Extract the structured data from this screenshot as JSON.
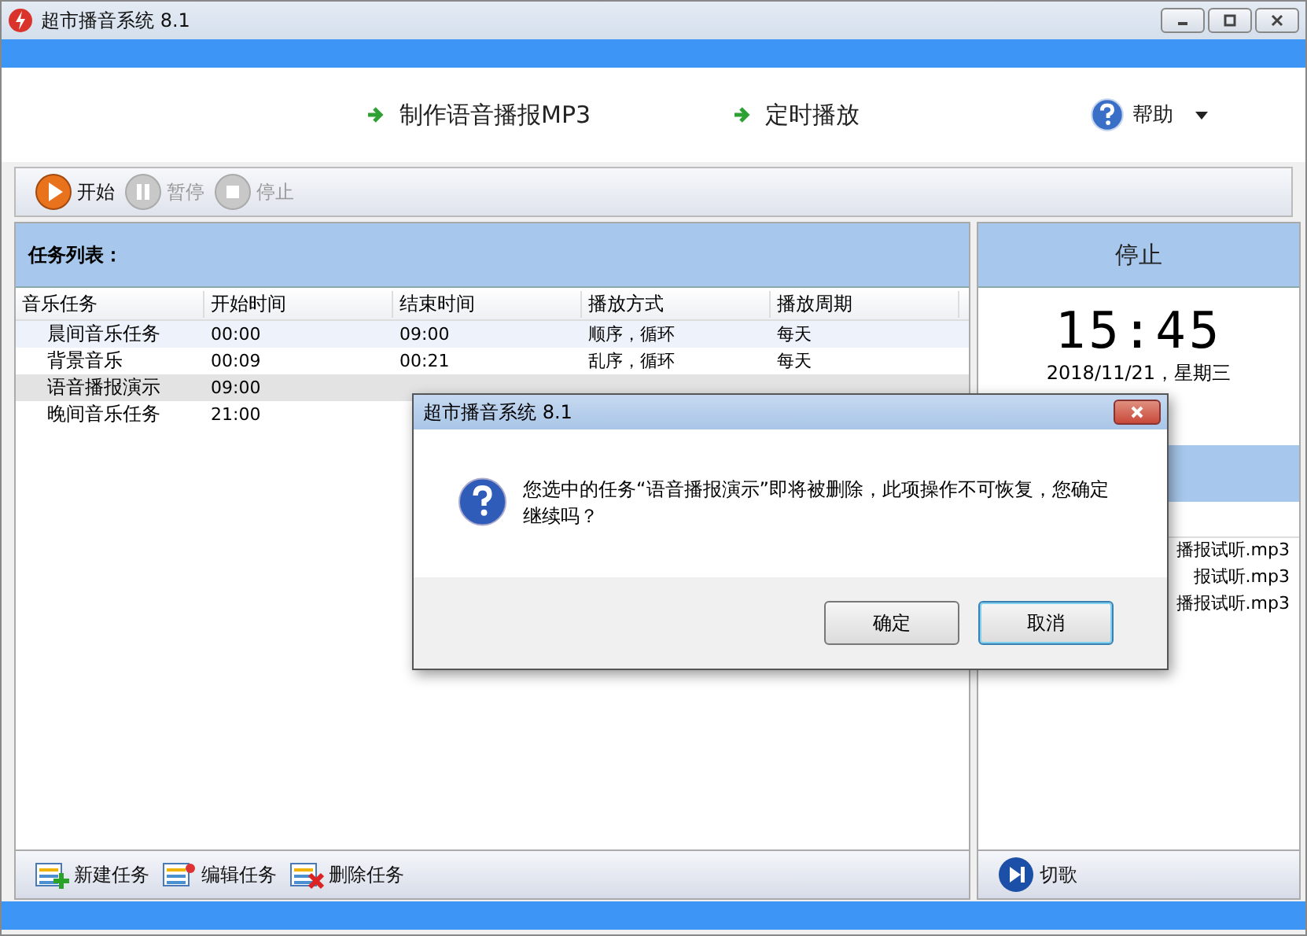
{
  "window": {
    "title": "超市播音系统 8.1"
  },
  "nav": [
    {
      "label": "制作语音播报MP3",
      "kind": "arrow"
    },
    {
      "label": "定时播放",
      "kind": "arrow"
    },
    {
      "label": "帮助",
      "kind": "help"
    }
  ],
  "toolbar": [
    {
      "label": "开始",
      "kind": "play",
      "disabled": false
    },
    {
      "label": "暂停",
      "kind": "pause",
      "disabled": true
    },
    {
      "label": "停止",
      "kind": "stop",
      "disabled": true
    }
  ],
  "task_panel": {
    "title": "任务列表：",
    "columns": [
      "音乐任务",
      "开始时间",
      "结束时间",
      "播放方式",
      "播放周期"
    ],
    "rows": [
      {
        "selected": false,
        "cells": [
          "晨间音乐任务",
          "00:00",
          "09:00",
          "顺序，循环",
          "每天"
        ]
      },
      {
        "selected": false,
        "cells": [
          "背景音乐",
          "00:09",
          "00:21",
          "乱序，循环",
          "每天"
        ]
      },
      {
        "selected": true,
        "cells": [
          "语音播报演示",
          "09:00"
        ]
      },
      {
        "selected": false,
        "cells": [
          "晚间音乐任务",
          "21:00"
        ]
      }
    ]
  },
  "status_panel": {
    "title": "停止",
    "time": "15:45",
    "date": "2018/11/21，星期三",
    "files": [
      "播报试听.mp3",
      "报试听.mp3",
      "播报试听.mp3"
    ]
  },
  "bottom_toolbar": [
    {
      "label": "新建任务",
      "kind": "new"
    },
    {
      "label": "编辑任务",
      "kind": "edit"
    },
    {
      "label": "删除任务",
      "kind": "delete"
    }
  ],
  "next_button": {
    "label": "切歌"
  },
  "dialog": {
    "title": "超市播音系统 8.1",
    "message": "您选中的任务“语音播报演示”即将被删除，此项操作不可恢复，您确定继续吗？",
    "buttons": [
      "确定",
      "取消"
    ]
  }
}
